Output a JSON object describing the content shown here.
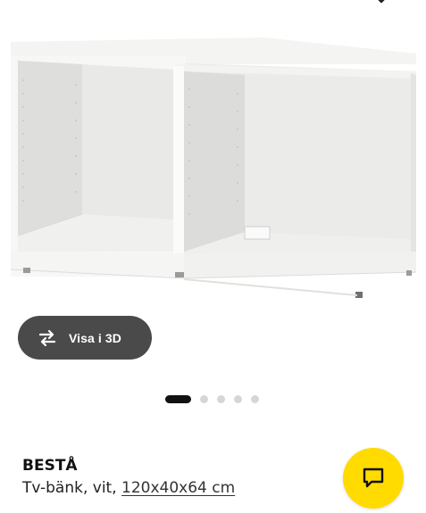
{
  "gallery": {
    "view_3d_label": "Visa i 3D",
    "dots": [
      {
        "active": true
      },
      {
        "active": false
      },
      {
        "active": false
      },
      {
        "active": false
      },
      {
        "active": false
      }
    ]
  },
  "product": {
    "name": "BESTÅ",
    "description": "Tv-bänk, vit, ",
    "size_link": "120x40x64 cm"
  },
  "icons": {
    "top": "chevron-down-icon",
    "view_3d": "rotate-3d-icon",
    "chat": "chat-bubble-icon"
  },
  "colors": {
    "chat_button": "#ffdb00",
    "view_3d_button": "#4a4a4a",
    "active_dot": "#111111",
    "inactive_dot": "#d6d6d6"
  }
}
